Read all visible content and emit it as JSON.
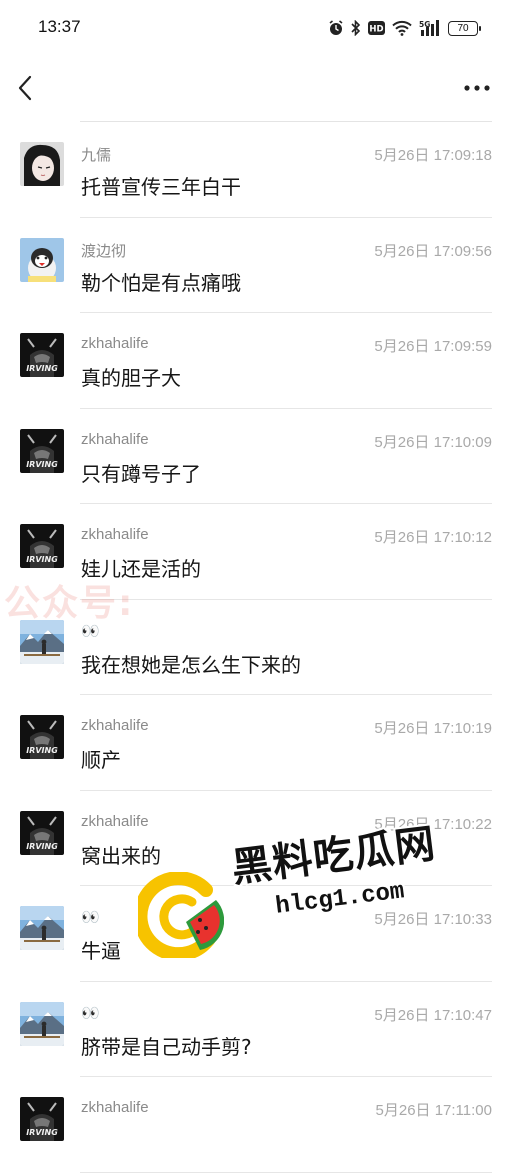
{
  "status_bar": {
    "time": "13:37",
    "battery": "70",
    "icons": [
      "alarm-icon",
      "bluetooth-icon",
      "hd-icon",
      "wifi-icon",
      "5g-signal-icon",
      "battery-icon"
    ]
  },
  "nav": {
    "back_icon": "chevron-left-icon",
    "more_icon": "more-dots-icon"
  },
  "messages": [
    {
      "name": "九儒",
      "time": "5月26日 17:09:18",
      "text": "托普宣传三年白干",
      "avatar": "anime"
    },
    {
      "name": "渡边彻",
      "time": "5月26日 17:09:56",
      "text": "勒个怕是有点痛哦",
      "avatar": "penguin"
    },
    {
      "name": "zkhahalife",
      "time": "5月26日 17:09:59",
      "text": "真的胆子大",
      "avatar": "irving"
    },
    {
      "name": "zkhahalife",
      "time": "5月26日 17:10:09",
      "text": "只有蹲号子了",
      "avatar": "irving"
    },
    {
      "name": "zkhahalife",
      "time": "5月26日 17:10:12",
      "text": "娃儿还是活的",
      "avatar": "irving"
    },
    {
      "name": "👀",
      "time": "",
      "text": "我在想她是怎么生下来的",
      "avatar": "landscape"
    },
    {
      "name": "zkhahalife",
      "time": "5月26日 17:10:19",
      "text": "顺产",
      "avatar": "irving"
    },
    {
      "name": "zkhahalife",
      "time": "5月26日 17:10:22",
      "text": "窝出来的",
      "avatar": "irving"
    },
    {
      "name": "👀",
      "time": "5月26日 17:10:33",
      "text": "牛逼",
      "avatar": "landscape"
    },
    {
      "name": "👀",
      "time": "5月26日 17:10:47",
      "text": "脐带是自己动手剪?",
      "avatar": "landscape"
    },
    {
      "name": "zkhahalife",
      "time": "5月26日 17:11:00",
      "text": "",
      "avatar": "irving"
    }
  ],
  "watermarks": {
    "public_account": "公众号:",
    "site_title": "黑料吃瓜网",
    "site_url": "hlcg1.com"
  },
  "colors": {
    "name": "#8a8a8a",
    "time": "#a9a9a9",
    "text": "#161616",
    "divider": "#e6e6e6"
  }
}
